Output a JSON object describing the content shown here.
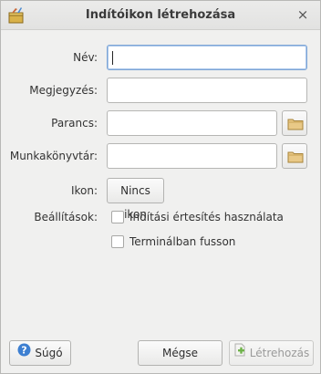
{
  "window": {
    "title": "Indítóikon létrehozása",
    "close_glyph": "×",
    "app_icon": "launcher-app-icon"
  },
  "form": {
    "name": {
      "label": "Név:",
      "value": ""
    },
    "comment": {
      "label": "Megjegyzés:",
      "value": ""
    },
    "command": {
      "label": "Parancs:",
      "value": "",
      "browse_icon": "folder-icon"
    },
    "workdir": {
      "label": "Munkakönyvtár:",
      "value": "",
      "browse_icon": "folder-icon"
    },
    "icon": {
      "label": "Ikon:",
      "button_label": "Nincs ikon"
    },
    "options": {
      "label": "Beállítások:",
      "startup_notify": {
        "label": "Indítási értesítés használata",
        "checked": false
      },
      "run_in_terminal": {
        "label": "Terminálban fusson",
        "checked": false
      }
    }
  },
  "buttons": {
    "help": {
      "label": "Súgó",
      "icon": "help-icon"
    },
    "cancel": {
      "label": "Mégse"
    },
    "create": {
      "label": "Létrehozás",
      "icon": "add-icon",
      "enabled": false
    }
  },
  "colors": {
    "focus_border": "#7fa6d6",
    "help_icon": "#3d7fd1",
    "add_icon": "#6fb24a"
  }
}
